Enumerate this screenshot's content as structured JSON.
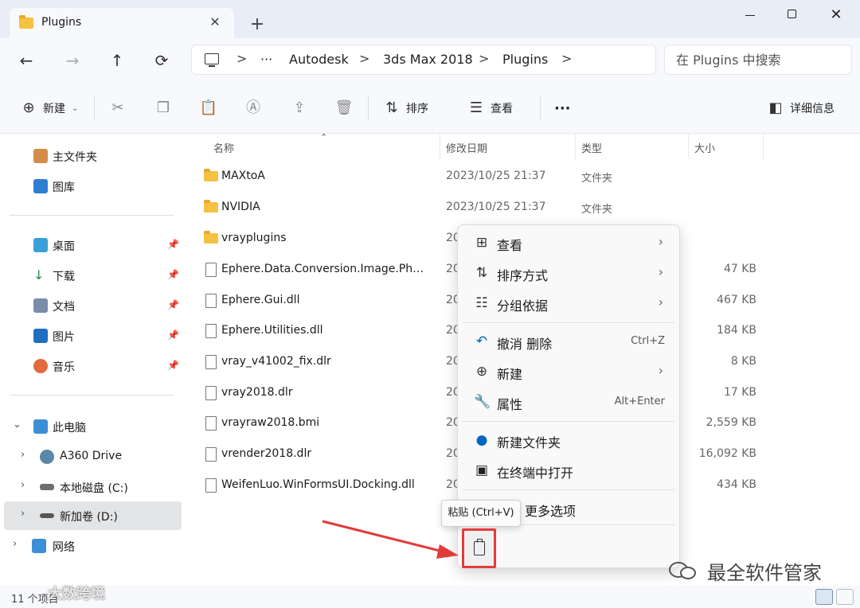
{
  "window": {
    "tab_title": "Plugins",
    "tab_close": "✕",
    "new_tab": "+",
    "minimize": "",
    "maximize": "",
    "close": "✕"
  },
  "nav": {
    "back": "←",
    "forward": "→",
    "up": "↑",
    "refresh": "⟳",
    "ellipsis": "···",
    "breadcrumbs": [
      "Autodesk",
      "3ds Max 2018",
      "Plugins"
    ],
    "sep": ">",
    "search_placeholder": "在 Plugins 中搜索"
  },
  "commandbar": {
    "new_label": "新建",
    "sort_label": "排序",
    "view_label": "查看",
    "more": "···",
    "details_label": "详细信息",
    "icons": [
      "plus-circle-icon",
      "cut-icon",
      "copy-icon",
      "paste-icon",
      "rename-icon",
      "share-icon",
      "delete-icon"
    ]
  },
  "sidebar": {
    "items": [
      {
        "label": "主文件夹",
        "icon": "home-icon"
      },
      {
        "label": "图库",
        "icon": "gallery-icon"
      },
      {
        "label": "桌面",
        "icon": "desktop-icon",
        "pinned": true
      },
      {
        "label": "下载",
        "icon": "download-icon",
        "pinned": true
      },
      {
        "label": "文档",
        "icon": "documents-icon",
        "pinned": true
      },
      {
        "label": "图片",
        "icon": "pictures-icon",
        "pinned": true
      },
      {
        "label": "音乐",
        "icon": "music-icon",
        "pinned": true
      },
      {
        "label": "此电脑",
        "icon": "this-pc-icon",
        "expanded": true
      },
      {
        "label": "A360 Drive",
        "icon": "cloud-drive-icon"
      },
      {
        "label": "本地磁盘 (C:)",
        "icon": "drive-icon"
      },
      {
        "label": "新加卷 (D:)",
        "icon": "drive-icon",
        "selected": true
      },
      {
        "label": "网络",
        "icon": "network-icon"
      }
    ]
  },
  "filelist": {
    "columns": {
      "name": "名称",
      "date": "修改日期",
      "type": "类型",
      "size": "大小"
    },
    "rows": [
      {
        "name": "MAXtoA",
        "date": "2023/10/25 21:37",
        "type": "文件夹",
        "size": "",
        "kind": "folder"
      },
      {
        "name": "NVIDIA",
        "date": "2023/10/25 21:37",
        "type": "文件夹",
        "size": "",
        "kind": "folder"
      },
      {
        "name": "vrayplugins",
        "date": "20",
        "type": "",
        "size": "",
        "kind": "folder"
      },
      {
        "name": "Ephere.Data.Conversion.Image.Phot...",
        "date": "20",
        "type": "",
        "size": "47 KB",
        "kind": "dll"
      },
      {
        "name": "Ephere.Gui.dll",
        "date": "20",
        "type": "",
        "size": "467 KB",
        "kind": "dll"
      },
      {
        "name": "Ephere.Utilities.dll",
        "date": "20",
        "type": "",
        "size": "184 KB",
        "kind": "dll"
      },
      {
        "name": "vray_v41002_fix.dlr",
        "date": "20",
        "type": "",
        "size": "8 KB",
        "kind": "file"
      },
      {
        "name": "vray2018.dlr",
        "date": "20",
        "type": "",
        "size": "17 KB",
        "kind": "file"
      },
      {
        "name": "vrayraw2018.bmi",
        "date": "20",
        "type": "",
        "size": "2,559 KB",
        "kind": "file"
      },
      {
        "name": "vrender2018.dlr",
        "date": "20",
        "type": "",
        "size": "16,092 KB",
        "kind": "file"
      },
      {
        "name": "WeifenLuo.WinFormsUI.Docking.dll",
        "date": "20",
        "type": "",
        "size": "434 KB",
        "kind": "dll"
      }
    ]
  },
  "context_menu": {
    "items": [
      {
        "label": "查看",
        "icon": "grid-icon",
        "submenu": true
      },
      {
        "label": "排序方式",
        "icon": "sort-icon",
        "submenu": true
      },
      {
        "label": "分组依据",
        "icon": "group-icon",
        "submenu": true
      },
      {
        "label": "撤消 删除",
        "icon": "undo-icon",
        "shortcut": "Ctrl+Z"
      },
      {
        "label": "新建",
        "icon": "plus-circle-icon",
        "submenu": true
      },
      {
        "label": "属性",
        "icon": "wrench-icon",
        "shortcut": "Alt+Enter"
      },
      {
        "label": "新建文件夹",
        "icon": "new-folder-icon"
      },
      {
        "label": "在终端中打开",
        "icon": "terminal-icon"
      },
      {
        "label": "更多选项",
        "icon": "more-options-icon"
      }
    ],
    "tooltip": "粘贴 (Ctrl+V)"
  },
  "statusbar": {
    "count": "11 个项目"
  },
  "watermark": {
    "text": "最全软件管家",
    "corner_text": "大数跨境"
  },
  "colors": {
    "accent": "#0067c0",
    "folder": "#f5c142",
    "highlight_box": "#e23b3b"
  }
}
